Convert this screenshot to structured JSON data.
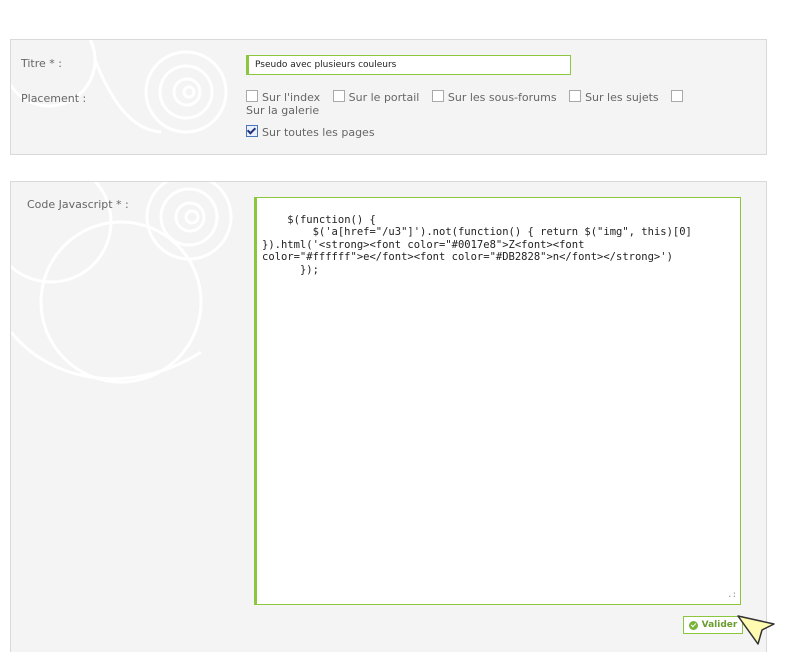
{
  "form": {
    "title_label": "Titre * :",
    "title_value": "Pseudo avec plusieurs couleurs",
    "placement_label": "Placement :",
    "placement_options": [
      {
        "label": "Sur l'index",
        "checked": false
      },
      {
        "label": "Sur le portail",
        "checked": false
      },
      {
        "label": "Sur les sous-forums",
        "checked": false
      },
      {
        "label": "Sur les sujets",
        "checked": false
      },
      {
        "label": "Sur la galerie",
        "checked": false
      },
      {
        "label": "Sur toutes les pages",
        "checked": true
      }
    ],
    "code_label": "Code Javascript * :",
    "code_value": "$(function() {\n        $('a[href=\"/u3\"]').not(function() { return $(\"img\", this)[0]\n}).html('<strong><font color=\"#0017e8\">Z<font><font\ncolor=\"#ffffff\">e</font><font color=\"#DB2828\">n</font></strong>')\n      });",
    "submit_label": "Valider"
  },
  "colors": {
    "accent": "#8cc63f",
    "panel_bg": "#f4f4f4",
    "panel_border": "#d9d9d9"
  },
  "icons": {
    "submit": "ok-check-icon",
    "checkbox_checked": "checkbox-checked-icon",
    "cursor": "arrow-cursor-icon"
  }
}
